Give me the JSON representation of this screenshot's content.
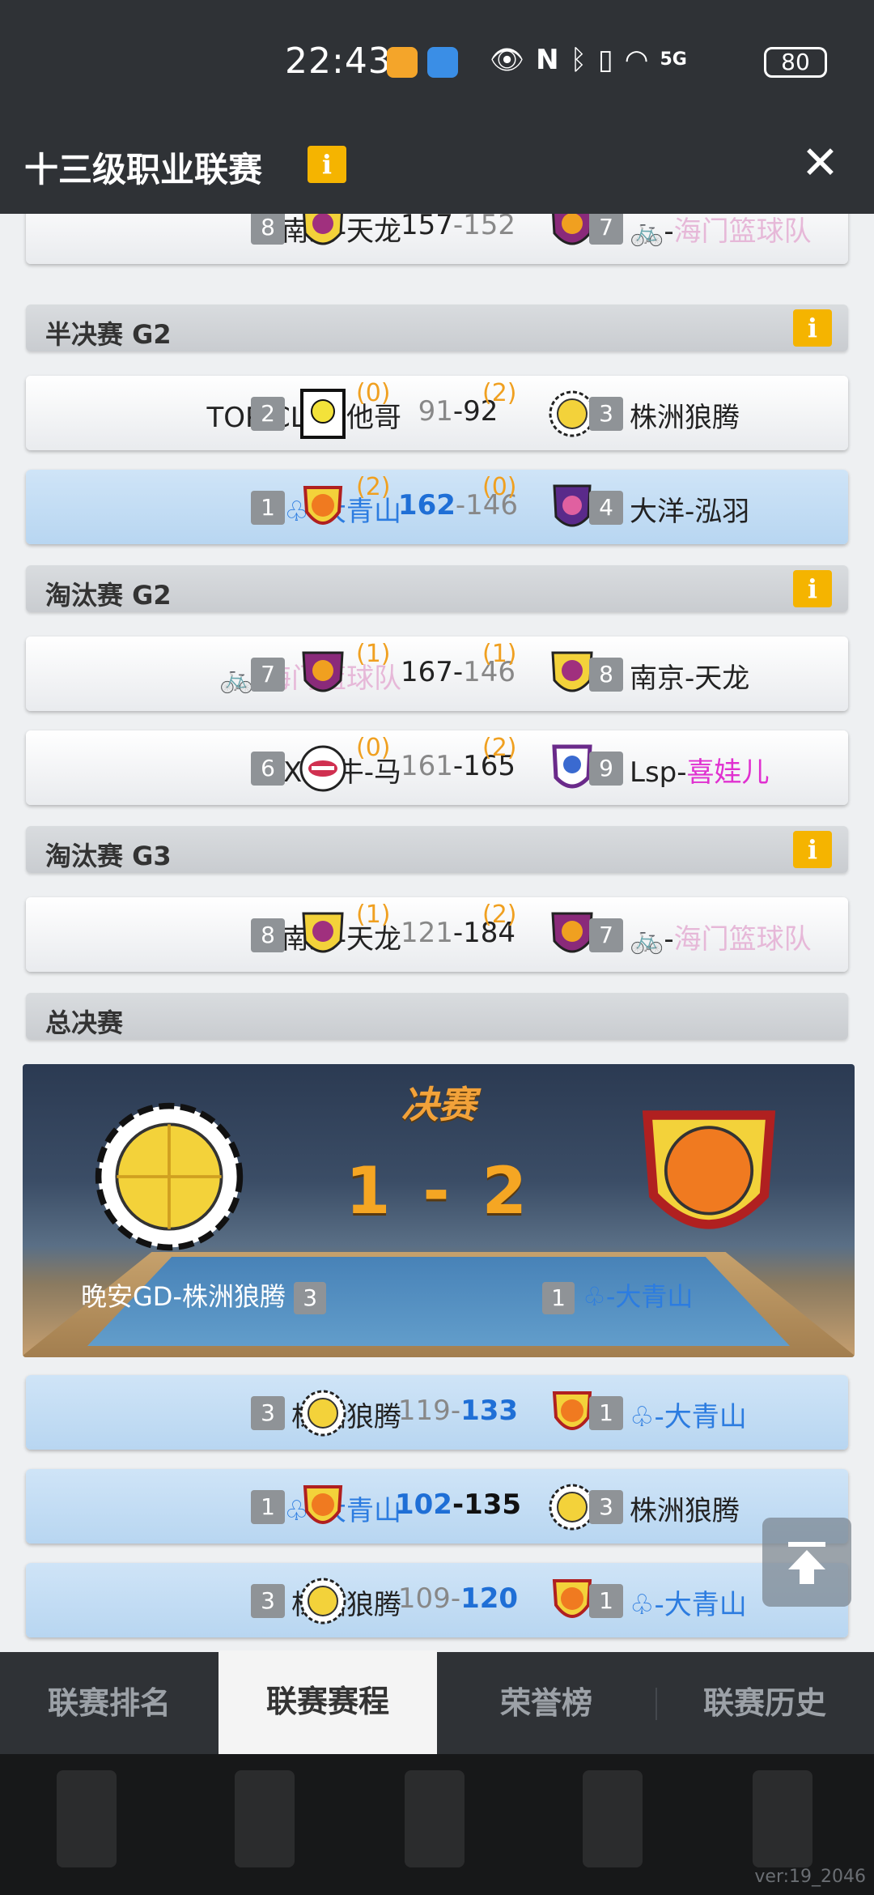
{
  "status_bar": {
    "time": "22:43",
    "battery": "80",
    "signal": "5G"
  },
  "header": {
    "title": "十三级职业联赛",
    "info": "i",
    "close": "✕"
  },
  "partial_match": {
    "left_name": "南京-天龙",
    "left_seed": "8",
    "score": "157-152",
    "score_a": "157",
    "dash": "-",
    "score_b": "152",
    "right_seed": "7",
    "right_name": "海门篮球队"
  },
  "sections": {
    "semis": "半决赛 G2",
    "elim2": "淘汰赛 G2",
    "elim3": "淘汰赛 G3",
    "finals": "总决赛"
  },
  "matches": [
    {
      "left_name": "TOP-CLY猫他哥",
      "left_seed": "2",
      "left_pts": "(0)",
      "score_a": "91",
      "dash": "-",
      "score_b": "92",
      "right_pts": "(2)",
      "right_seed": "3",
      "right_name": "株洲狼腾"
    },
    {
      "left_prefix": "♧-",
      "left_name": "大青山",
      "left_seed": "1",
      "left_pts": "(2)",
      "score_a": "162",
      "dash": "-",
      "score_b": "146",
      "right_pts": "(0)",
      "right_seed": "4",
      "right_name": "大洋-泓羽"
    },
    {
      "left_prefix": "-",
      "left_name": "海门篮球队",
      "left_seed": "7",
      "left_pts": "(1)",
      "score_a": "167",
      "dash": "-",
      "score_b": "146",
      "right_pts": "(1)",
      "right_seed": "8",
      "right_name": "南京-天龙"
    },
    {
      "left_name": "Xba牛-马",
      "left_seed": "6",
      "left_pts": "(0)",
      "score_a": "161",
      "dash": "-",
      "score_b": "165",
      "right_pts": "(2)",
      "right_seed": "9",
      "right_prefix": "Lsp-",
      "right_name": "喜娃儿"
    },
    {
      "left_name": "南京-天龙",
      "left_seed": "8",
      "left_pts": "(1)",
      "score_a": "121",
      "dash": "-",
      "score_b": "184",
      "right_pts": "(2)",
      "right_seed": "7",
      "right_prefix": "-",
      "right_name": "海门篮球队"
    }
  ],
  "final_banner": {
    "title": "决赛",
    "score": "1 - 2",
    "left_name": "晚安GD-株洲狼腾",
    "left_seed": "3",
    "right_seed": "1",
    "right_name": "♧-大青山"
  },
  "final_games": [
    {
      "left_name": "株洲狼腾",
      "left_seed": "3",
      "score_a": "119",
      "dash": "-",
      "score_b": "133",
      "right_seed": "1",
      "right_name": "♧-大青山"
    },
    {
      "left_name": "♧-大青山",
      "left_seed": "1",
      "score_a": "102",
      "dash": "-",
      "score_b": "135",
      "right_seed": "3",
      "right_name": "株洲狼腾"
    },
    {
      "left_name": "株洲狼腾",
      "left_seed": "3",
      "score_a": "109",
      "dash": "-",
      "score_b": "120",
      "right_seed": "1",
      "right_name": "♧-大青山"
    }
  ],
  "tabs": [
    "联赛排名",
    "联赛赛程",
    "荣誉榜",
    "联赛历史"
  ],
  "version": "ver:19_2046",
  "colors": {
    "accent_yellow": "#f5b400",
    "points_orange": "#f0a020",
    "highlight_blue": "#b8d6f1",
    "link_blue": "#2c7ce0",
    "pink": "#e6b8d8",
    "magenta": "#e030d0"
  }
}
